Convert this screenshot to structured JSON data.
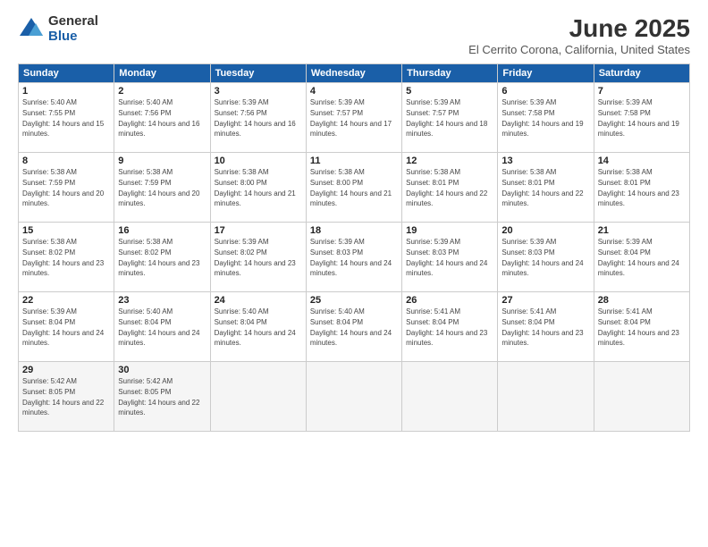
{
  "logo": {
    "general": "General",
    "blue": "Blue"
  },
  "title": "June 2025",
  "subtitle": "El Cerrito Corona, California, United States",
  "header_days": [
    "Sunday",
    "Monday",
    "Tuesday",
    "Wednesday",
    "Thursday",
    "Friday",
    "Saturday"
  ],
  "weeks": [
    [
      {
        "num": "1",
        "rise": "5:40 AM",
        "set": "7:55 PM",
        "daylight": "14 hours and 15 minutes."
      },
      {
        "num": "2",
        "rise": "5:40 AM",
        "set": "7:56 PM",
        "daylight": "14 hours and 16 minutes."
      },
      {
        "num": "3",
        "rise": "5:39 AM",
        "set": "7:56 PM",
        "daylight": "14 hours and 16 minutes."
      },
      {
        "num": "4",
        "rise": "5:39 AM",
        "set": "7:57 PM",
        "daylight": "14 hours and 17 minutes."
      },
      {
        "num": "5",
        "rise": "5:39 AM",
        "set": "7:57 PM",
        "daylight": "14 hours and 18 minutes."
      },
      {
        "num": "6",
        "rise": "5:39 AM",
        "set": "7:58 PM",
        "daylight": "14 hours and 19 minutes."
      },
      {
        "num": "7",
        "rise": "5:39 AM",
        "set": "7:58 PM",
        "daylight": "14 hours and 19 minutes."
      }
    ],
    [
      {
        "num": "8",
        "rise": "5:38 AM",
        "set": "7:59 PM",
        "daylight": "14 hours and 20 minutes."
      },
      {
        "num": "9",
        "rise": "5:38 AM",
        "set": "7:59 PM",
        "daylight": "14 hours and 20 minutes."
      },
      {
        "num": "10",
        "rise": "5:38 AM",
        "set": "8:00 PM",
        "daylight": "14 hours and 21 minutes."
      },
      {
        "num": "11",
        "rise": "5:38 AM",
        "set": "8:00 PM",
        "daylight": "14 hours and 21 minutes."
      },
      {
        "num": "12",
        "rise": "5:38 AM",
        "set": "8:01 PM",
        "daylight": "14 hours and 22 minutes."
      },
      {
        "num": "13",
        "rise": "5:38 AM",
        "set": "8:01 PM",
        "daylight": "14 hours and 22 minutes."
      },
      {
        "num": "14",
        "rise": "5:38 AM",
        "set": "8:01 PM",
        "daylight": "14 hours and 23 minutes."
      }
    ],
    [
      {
        "num": "15",
        "rise": "5:38 AM",
        "set": "8:02 PM",
        "daylight": "14 hours and 23 minutes."
      },
      {
        "num": "16",
        "rise": "5:38 AM",
        "set": "8:02 PM",
        "daylight": "14 hours and 23 minutes."
      },
      {
        "num": "17",
        "rise": "5:39 AM",
        "set": "8:02 PM",
        "daylight": "14 hours and 23 minutes."
      },
      {
        "num": "18",
        "rise": "5:39 AM",
        "set": "8:03 PM",
        "daylight": "14 hours and 24 minutes."
      },
      {
        "num": "19",
        "rise": "5:39 AM",
        "set": "8:03 PM",
        "daylight": "14 hours and 24 minutes."
      },
      {
        "num": "20",
        "rise": "5:39 AM",
        "set": "8:03 PM",
        "daylight": "14 hours and 24 minutes."
      },
      {
        "num": "21",
        "rise": "5:39 AM",
        "set": "8:04 PM",
        "daylight": "14 hours and 24 minutes."
      }
    ],
    [
      {
        "num": "22",
        "rise": "5:39 AM",
        "set": "8:04 PM",
        "daylight": "14 hours and 24 minutes."
      },
      {
        "num": "23",
        "rise": "5:40 AM",
        "set": "8:04 PM",
        "daylight": "14 hours and 24 minutes."
      },
      {
        "num": "24",
        "rise": "5:40 AM",
        "set": "8:04 PM",
        "daylight": "14 hours and 24 minutes."
      },
      {
        "num": "25",
        "rise": "5:40 AM",
        "set": "8:04 PM",
        "daylight": "14 hours and 24 minutes."
      },
      {
        "num": "26",
        "rise": "5:41 AM",
        "set": "8:04 PM",
        "daylight": "14 hours and 23 minutes."
      },
      {
        "num": "27",
        "rise": "5:41 AM",
        "set": "8:04 PM",
        "daylight": "14 hours and 23 minutes."
      },
      {
        "num": "28",
        "rise": "5:41 AM",
        "set": "8:04 PM",
        "daylight": "14 hours and 23 minutes."
      }
    ],
    [
      {
        "num": "29",
        "rise": "5:42 AM",
        "set": "8:05 PM",
        "daylight": "14 hours and 22 minutes."
      },
      {
        "num": "30",
        "rise": "5:42 AM",
        "set": "8:05 PM",
        "daylight": "14 hours and 22 minutes."
      },
      null,
      null,
      null,
      null,
      null
    ]
  ],
  "labels": {
    "sunrise": "Sunrise:",
    "sunset": "Sunset:",
    "daylight": "Daylight:"
  }
}
